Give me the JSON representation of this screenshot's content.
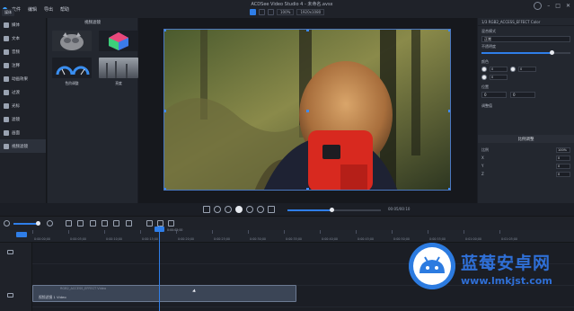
{
  "app": {
    "menu": [
      "文件",
      "编辑",
      "导出",
      "帮助"
    ],
    "tab": "媒体",
    "title": "ACDSee Video Studio 4 - 未命名.avsx",
    "zoom": "100%",
    "resolution": "1920x1080",
    "accent": "#2f7ee8"
  },
  "leftnav": [
    {
      "label": "媒体",
      "icon": "media-icon"
    },
    {
      "label": "文本",
      "icon": "text-icon"
    },
    {
      "label": "音频",
      "icon": "audio-icon"
    },
    {
      "label": "注释",
      "icon": "annotation-icon"
    },
    {
      "label": "动画效果",
      "icon": "animation-icon"
    },
    {
      "label": "过渡",
      "icon": "transition-icon"
    },
    {
      "label": "光标",
      "icon": "cursor-icon"
    },
    {
      "label": "滤镜",
      "icon": "filter-icon"
    },
    {
      "label": "画面",
      "icon": "frame-icon"
    },
    {
      "label": "视频滤镜",
      "icon": "video-filter-icon"
    }
  ],
  "fxpanel": {
    "title": "视频滤镜",
    "items": [
      {
        "label": "",
        "icon": "animal-thumb"
      },
      {
        "label": "",
        "icon": "rgb-thumb"
      },
      {
        "label": "色阶调整",
        "icon": "gauge-thumb"
      },
      {
        "label": "亮度",
        "icon": "fog-thumb"
      }
    ]
  },
  "props": {
    "title": "1/3 RGB2_ACCESS_EFFECT Color",
    "blend_label": "混合模式",
    "blend_value": "正常",
    "opacity_label": "不透明度",
    "color_label": "颜色",
    "color_values": [
      "0",
      "0",
      "0"
    ],
    "pos_label": "位置",
    "pos_x": "0",
    "pos_y": "0",
    "bottom_label": "调整值",
    "tab_label": "比例调整",
    "rows": [
      {
        "label": "比例",
        "value": "100%"
      },
      {
        "label": "X",
        "value": "0"
      },
      {
        "label": "Y",
        "value": "0"
      },
      {
        "label": "Z",
        "value": "0"
      }
    ]
  },
  "transport": {
    "time": "00:05/00:10",
    "progress": 0.47
  },
  "timeline": {
    "ruler": [
      "0:00:00;00",
      "0:00:05;00",
      "0:00:10;00",
      "0:00:15;00",
      "0:00:20;00",
      "0:00:25;00",
      "0:00:30;00",
      "0:00:35;00",
      "0:00:40;00",
      "0:00:45;00",
      "0:00:50;00",
      "0:00:55;00",
      "0:01:00;00",
      "0:01:05;00"
    ],
    "playhead_label": "0:00:05;00",
    "clip_title": "RGB2_ACCESS_EFFECT Video",
    "clip_label": "视频滤镜 1 Video"
  },
  "watermark": {
    "name": "蓝莓安卓网",
    "url": "www.lmkjst.com"
  }
}
